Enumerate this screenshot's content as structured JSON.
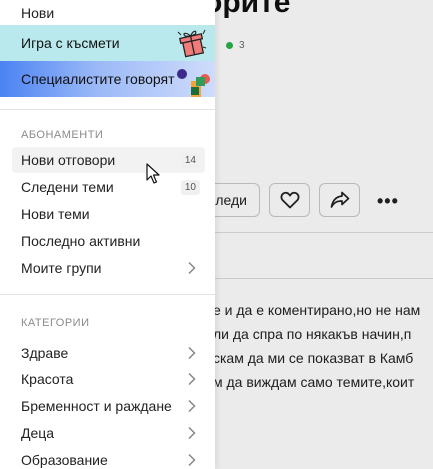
{
  "background": {
    "title_fragment": "орите",
    "online_count": "3",
    "follow_label": "леди",
    "body_lines": [
      "е и да е коментирано,но не нам",
      " ли да спра по някакъв начин,п",
      "скам да ми се показват в Камб",
      "м да виждам само темите,коит"
    ]
  },
  "menu": {
    "top_item": "Нови",
    "promos": {
      "luck": "Игра с късмети",
      "specialists": "Специалистите говорят"
    },
    "subscriptions": {
      "title": "АБОНАМЕНТИ",
      "items": [
        {
          "label": "Нови отговори",
          "count": "14"
        },
        {
          "label": "Следени теми",
          "count": "10"
        },
        {
          "label": "Нови теми",
          "count": ""
        },
        {
          "label": "Последно активни",
          "count": ""
        },
        {
          "label": "Моите групи",
          "count": ""
        }
      ]
    },
    "categories": {
      "title": "КАТЕГОРИИ",
      "items": [
        {
          "label": "Здраве"
        },
        {
          "label": "Красота"
        },
        {
          "label": "Бременност и раждане"
        },
        {
          "label": "Деца"
        },
        {
          "label": "Образование"
        }
      ]
    }
  },
  "colors": {
    "promo_luck_bg": "#b9e9ec",
    "promo_spec_bg": "#4b83f3",
    "online_dot": "#2bb14a"
  }
}
